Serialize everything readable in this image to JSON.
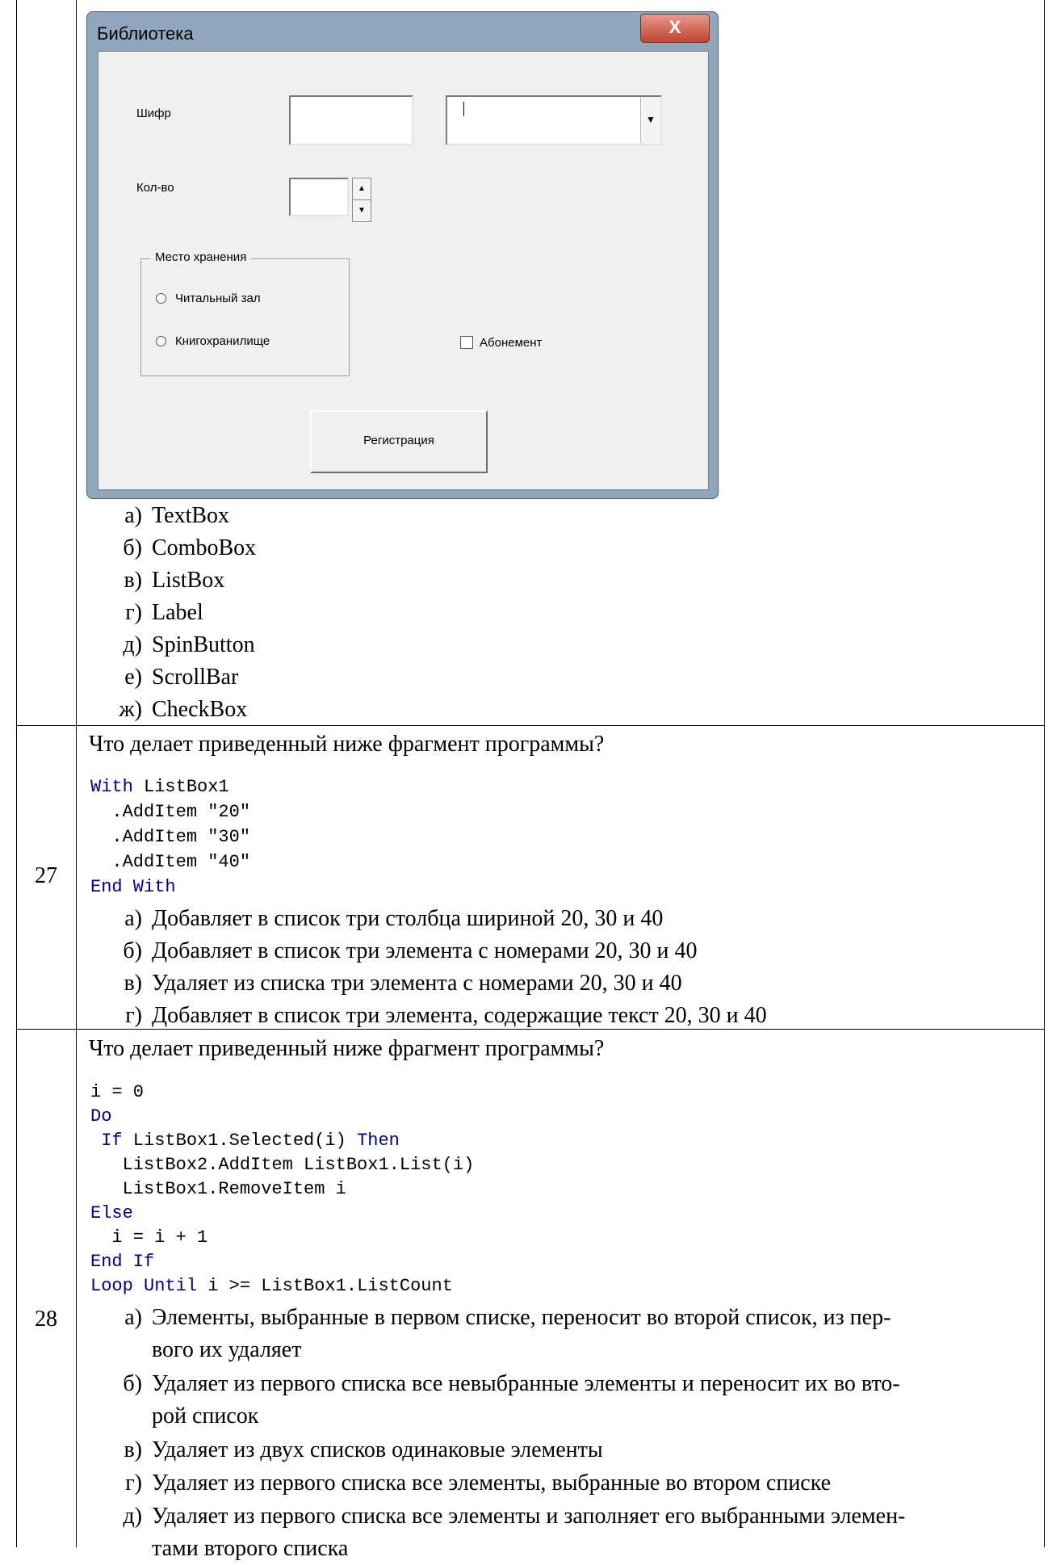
{
  "form": {
    "title": "Библиотека",
    "close_label": "X",
    "cipher_label": "Шифр",
    "qty_label": "Кол-во",
    "storage_frame_label": "Место хранения",
    "radio1_label": "Читальный зал",
    "radio2_label": "Книгохранилище",
    "checkbox_label": "Абонемент",
    "register_button": "Регистрация"
  },
  "q26_options": [
    {
      "letter": "а)",
      "text": "TextBox"
    },
    {
      "letter": "б)",
      "text": "ComboBox"
    },
    {
      "letter": "в)",
      "text": "ListBox"
    },
    {
      "letter": "г)",
      "text": "Label"
    },
    {
      "letter": "д)",
      "text": "SpinButton"
    },
    {
      "letter": "е)",
      "text": "ScrollBar"
    },
    {
      "letter": "ж)",
      "text": "CheckBox"
    }
  ],
  "q27": {
    "number": "27",
    "question": "Что делает приведенный ниже фрагмент программы?",
    "code": {
      "l1_kw": "With",
      "l1_rest": " ListBox1",
      "l2": "  .AddItem \"20\"",
      "l3": "  .AddItem \"30\"",
      "l4": "  .AddItem \"40\"",
      "l5_kw": "End With"
    },
    "options": [
      {
        "letter": "а)",
        "text": "Добавляет в список три столбца шириной 20, 30 и 40"
      },
      {
        "letter": "б)",
        "text": "Добавляет в список три элемента с номерами 20, 30 и 40"
      },
      {
        "letter": "в)",
        "text": "Удаляет из списка три элемента с номерами 20, 30 и 40"
      },
      {
        "letter": "г)",
        "text": "Добавляет в список три элемента, содержащие текст 20, 30 и 40"
      }
    ]
  },
  "q28": {
    "number": "28",
    "question": "Что делает приведенный ниже фрагмент программы?",
    "code": {
      "l1": "i = 0",
      "l2_kw": "Do",
      "l3_kw1": " If",
      "l3_mid": " ListBox1.Selected(i) ",
      "l3_kw2": "Then",
      "l4": "   ListBox2.AddItem ListBox1.List(i)",
      "l5": "   ListBox1.RemoveItem i",
      "l6_kw": "Else",
      "l7": "  i = i + 1",
      "l8_kw": "End If",
      "l9_kw": "Loop Until",
      "l9_rest": " i >= ListBox1.ListCount"
    },
    "options": [
      {
        "letter": "а)",
        "text": "Элементы, выбранные в первом списке, переносит во второй список, из пер-",
        "text2": "вого их удаляет"
      },
      {
        "letter": "б)",
        "text": "Удаляет из первого списка все невыбранные элементы и переносит их во вто-",
        "text2": "рой список"
      },
      {
        "letter": "в)",
        "text": "Удаляет из двух списков одинаковые элементы"
      },
      {
        "letter": "г)",
        "text": "Удаляет из первого списка все элементы, выбранные во втором списке"
      },
      {
        "letter": "д)",
        "text": "Удаляет из первого списка все элементы и заполняет его выбранными элемен-",
        "text2": "тами второго списка"
      }
    ]
  }
}
